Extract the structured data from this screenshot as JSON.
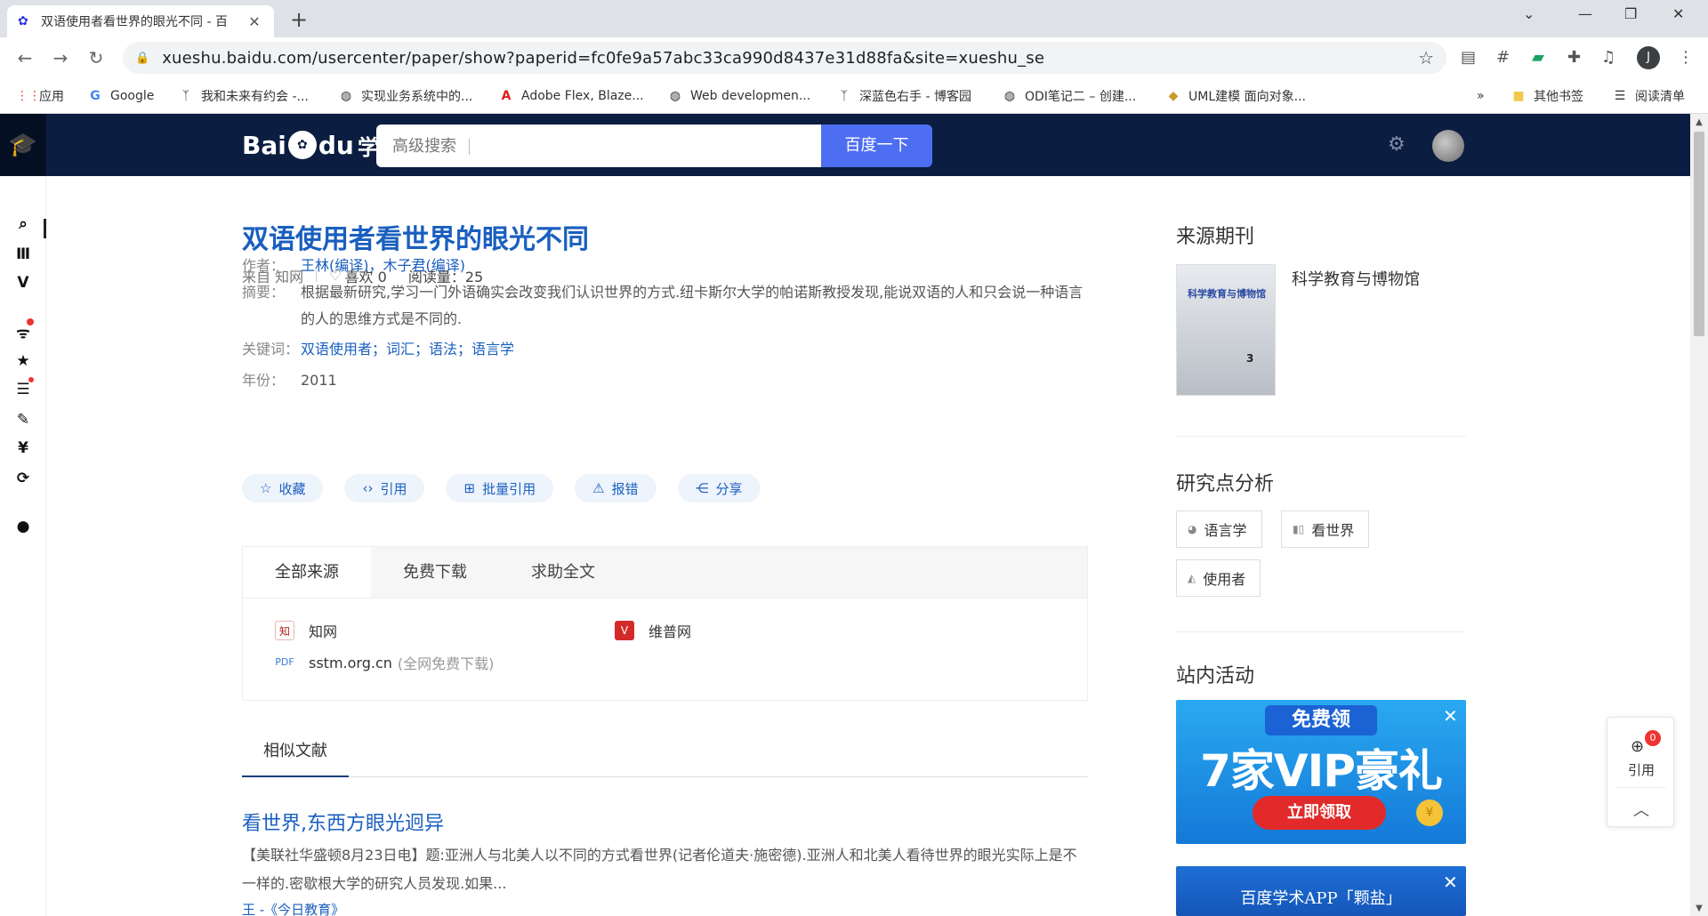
{
  "browser": {
    "tab_title": "双语使用者看世界的眼光不同 - 百",
    "url": "xueshu.baidu.com/usercenter/paper/show?paperid=fc0fe9a57abc33ca990d8437e31d88fa&site=xueshu_se",
    "profile_initial": "J",
    "bookmarks": [
      "应用",
      "Google",
      "我和未来有约会 -...",
      "实现业务系统中的...",
      "Adobe Flex, Blaze...",
      "Web developmen...",
      "深蓝色右手 - 博客园",
      "ODI笔记二 – 创建...",
      "UML建模 面向对象..."
    ],
    "more_bookmarks": "»",
    "other_bookmarks": "其他书签",
    "reading_list": "阅读清单"
  },
  "header": {
    "logo_text_1": "Bai",
    "logo_text_2": "du",
    "logo_suffix": "学术",
    "search_placeholder": "高级搜索",
    "search_button": "百度一下"
  },
  "paper": {
    "title": "双语使用者看世界的眼光不同",
    "source": "来自 知网",
    "likes": "喜欢 0",
    "reads": "阅读量：25",
    "author_label": "作者：",
    "authors": "王林(编译)，木子君(编译)",
    "abstract_label": "摘要：",
    "abstract": "根据最新研究,学习一门外语确实会改变我们认识世界的方式.纽卡斯尔大学的帕诺斯教授发现,能说双语的人和只会说一种语言的人的思维方式是不同的.",
    "keywords_label": "关键词：",
    "keywords": "双语使用者；词汇；语法；语言学",
    "year_label": "年份：",
    "year": "2011",
    "actions": [
      "收藏",
      "引用",
      "批量引用",
      "报错",
      "分享"
    ]
  },
  "sources": {
    "tabs": [
      "全部来源",
      "免费下载",
      "求助全文"
    ],
    "item1": "知网",
    "item2": "维普网",
    "item3": "sstm.org.cn",
    "item3_note": "(全网免费下载)",
    "pdf_label": "PDF"
  },
  "similar": {
    "tab": "相似文献",
    "title": "看世界,东西方眼光迥异",
    "desc": "【美联社华盛顿8月23日电】题:亚洲人与北美人以不同的方式看世界(记者伦道夫·施密德).亚洲人和北美人看待世界的眼光实际上是不一样的.密歇根大学的研究人员发现.如果...",
    "source": "王 -《今日教育》"
  },
  "sidebar": {
    "journal_heading": "来源期刊",
    "journal_name": "科学教育与博物馆",
    "cover_title": "科学教育与博物馆",
    "cover_num": "3",
    "analysis_heading": "研究点分析",
    "tags": [
      "语言学",
      "看世界",
      "使用者"
    ],
    "activity_heading": "站内活动",
    "banner1_top": "免费领",
    "banner1_main": "7家VIP豪礼",
    "banner1_btn": "立即领取",
    "banner2_text": "百度学术APP「颗盐」"
  },
  "float_widget": {
    "count": "0",
    "label": "引用"
  },
  "colors": {
    "nav_bg": "#0b1d40",
    "link": "#1a5fbf",
    "search_btn": "#4e6ef2"
  }
}
